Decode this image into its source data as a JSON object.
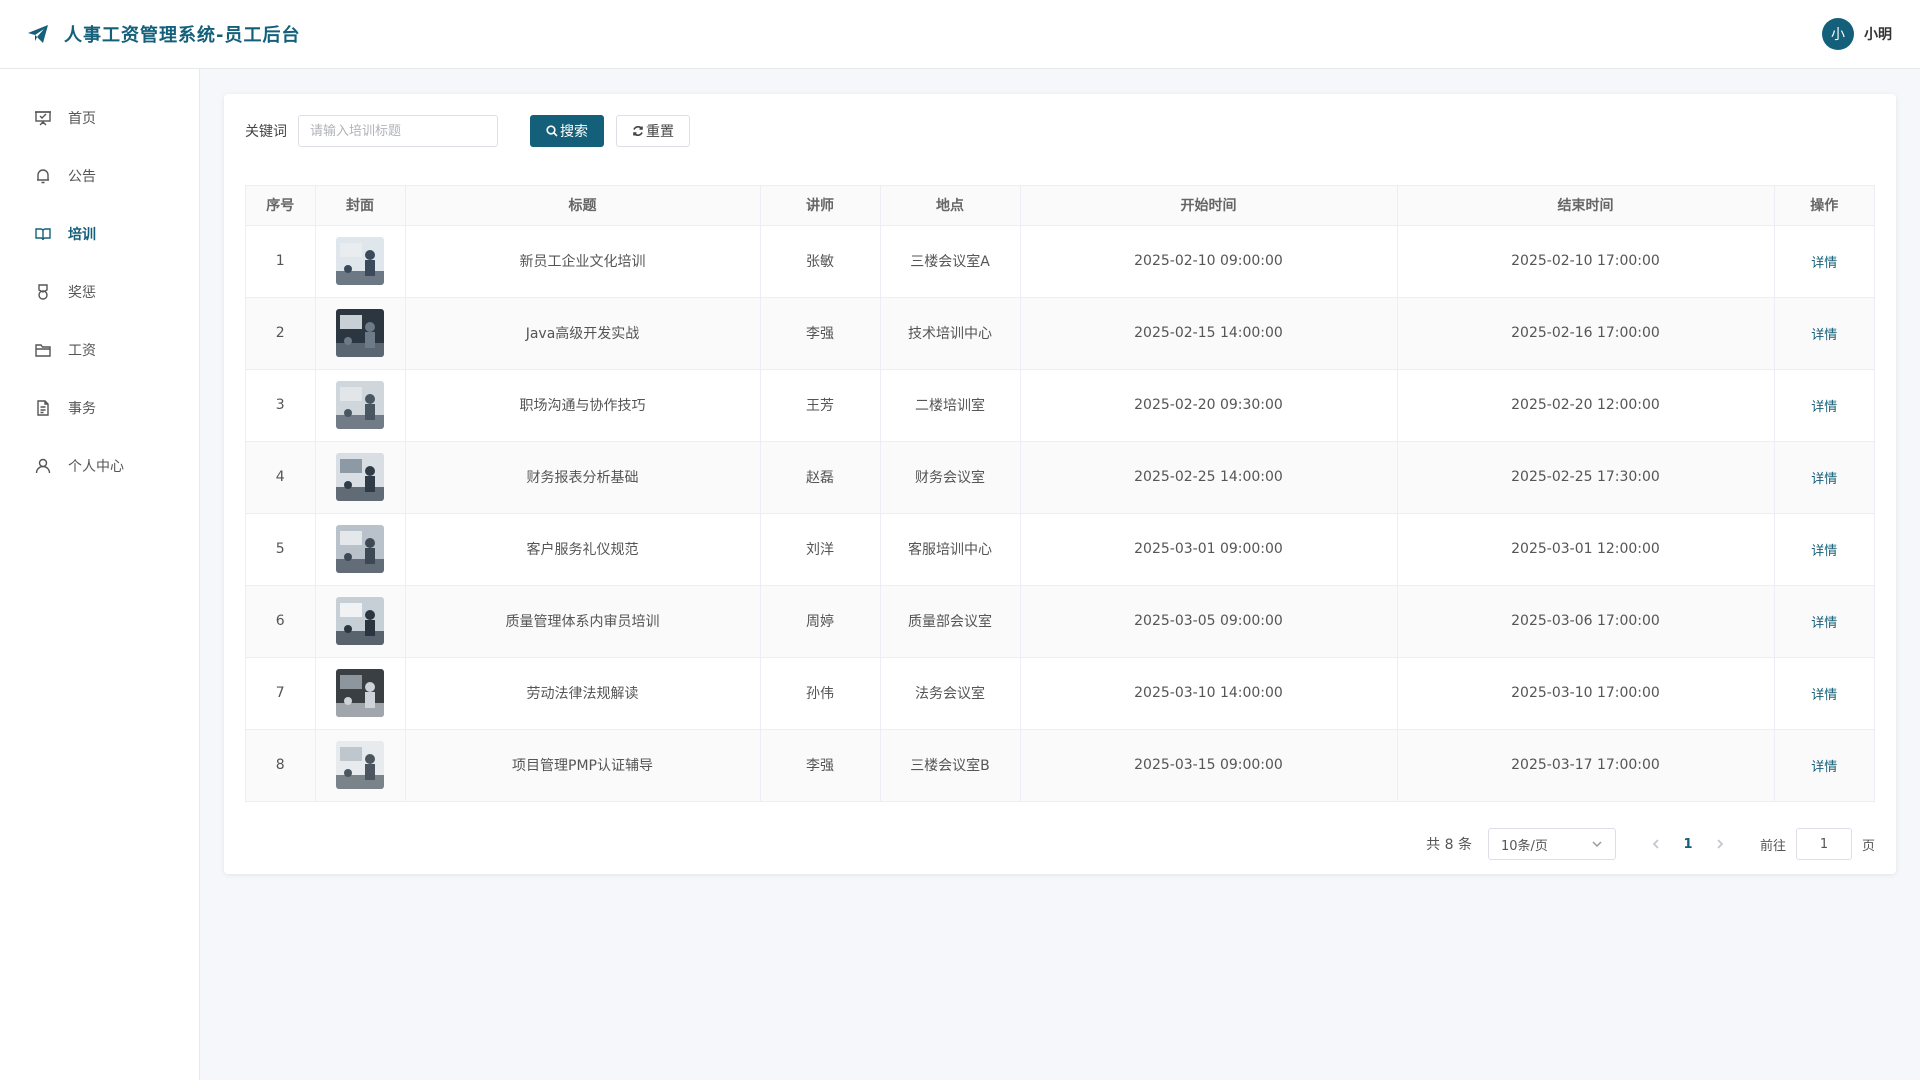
{
  "header": {
    "title": "人事工资管理系统-员工后台",
    "user_avatar": "小",
    "user_name": "小明"
  },
  "sidebar": {
    "items": [
      {
        "label": "首页",
        "icon": "presentation-icon"
      },
      {
        "label": "公告",
        "icon": "bell-icon"
      },
      {
        "label": "培训",
        "icon": "book-icon",
        "active": true
      },
      {
        "label": "奖惩",
        "icon": "medal-icon"
      },
      {
        "label": "工资",
        "icon": "folder-icon"
      },
      {
        "label": "事务",
        "icon": "document-icon"
      },
      {
        "label": "个人中心",
        "icon": "user-icon"
      }
    ]
  },
  "search": {
    "label": "关键词",
    "placeholder": "请输入培训标题",
    "value": "",
    "search_button": "搜索",
    "reset_button": "重置"
  },
  "table": {
    "columns": [
      "序号",
      "封面",
      "标题",
      "讲师",
      "地点",
      "开始时间",
      "结束时间",
      "操作"
    ],
    "action_label": "详情",
    "rows": [
      {
        "no": "1",
        "title": "新员工企业文化培训",
        "teacher": "张敏",
        "location": "三楼会议室A",
        "start": "2025-02-10 09:00:00",
        "end": "2025-02-10 17:00:00"
      },
      {
        "no": "2",
        "title": "Java高级开发实战",
        "teacher": "李强",
        "location": "技术培训中心",
        "start": "2025-02-15 14:00:00",
        "end": "2025-02-16 17:00:00"
      },
      {
        "no": "3",
        "title": "职场沟通与协作技巧",
        "teacher": "王芳",
        "location": "二楼培训室",
        "start": "2025-02-20 09:30:00",
        "end": "2025-02-20 12:00:00"
      },
      {
        "no": "4",
        "title": "财务报表分析基础",
        "teacher": "赵磊",
        "location": "财务会议室",
        "start": "2025-02-25 14:00:00",
        "end": "2025-02-25 17:30:00"
      },
      {
        "no": "5",
        "title": "客户服务礼仪规范",
        "teacher": "刘洋",
        "location": "客服培训中心",
        "start": "2025-03-01 09:00:00",
        "end": "2025-03-01 12:00:00"
      },
      {
        "no": "6",
        "title": "质量管理体系内审员培训",
        "teacher": "周婷",
        "location": "质量部会议室",
        "start": "2025-03-05 09:00:00",
        "end": "2025-03-06 17:00:00"
      },
      {
        "no": "7",
        "title": "劳动法律法规解读",
        "teacher": "孙伟",
        "location": "法务会议室",
        "start": "2025-03-10 14:00:00",
        "end": "2025-03-10 17:00:00"
      },
      {
        "no": "8",
        "title": "项目管理PMP认证辅导",
        "teacher": "李强",
        "location": "三楼会议室B",
        "start": "2025-03-15 09:00:00",
        "end": "2025-03-17 17:00:00"
      }
    ]
  },
  "pagination": {
    "total_text": "共 8 条",
    "page_size": "10条/页",
    "current_page": "1",
    "goto_label": "前往",
    "goto_value": "1",
    "page_unit": "页"
  },
  "colors": {
    "accent": "#14607a"
  }
}
